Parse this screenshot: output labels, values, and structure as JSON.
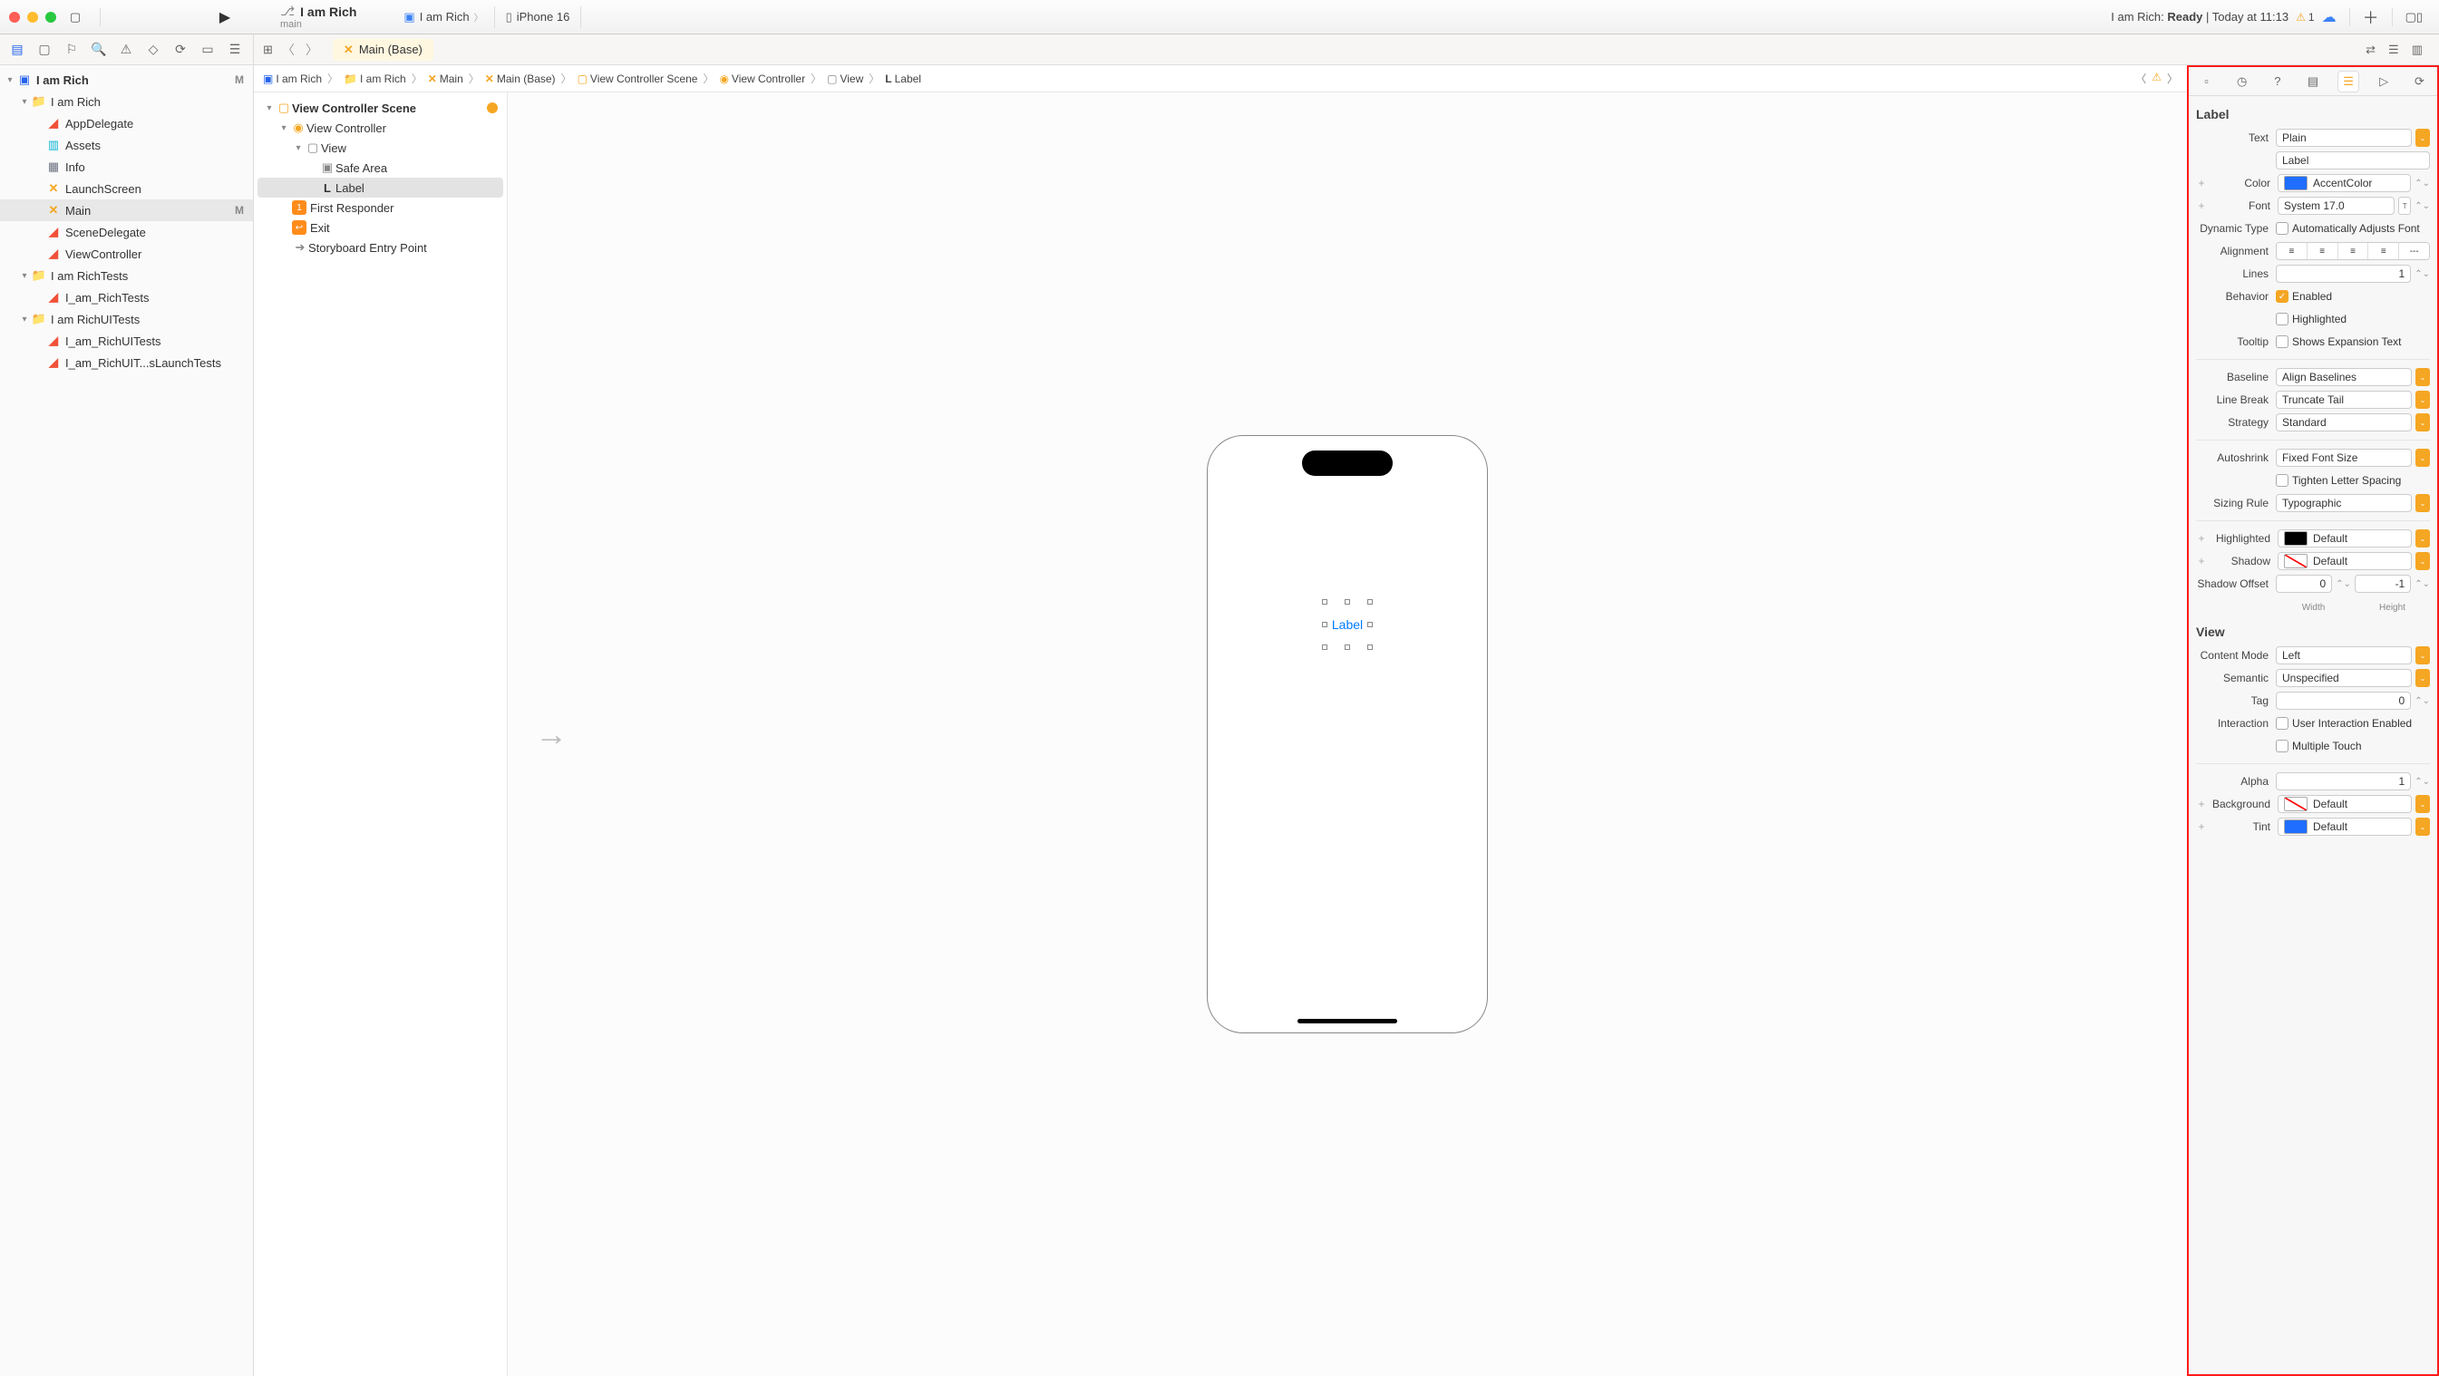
{
  "toolbar": {
    "scheme_title": "I am Rich",
    "scheme_branch": "main",
    "tab_scheme": "I am Rich",
    "tab_device": "iPhone 16",
    "status_prefix": "I am Rich: ",
    "status_bold": "Ready",
    "status_suffix": " | Today at 11:13",
    "warning_count": "1"
  },
  "filetab": {
    "label": "Main (Base)"
  },
  "navigator": {
    "project": "I am Rich",
    "project_m": "M",
    "target": "I am Rich",
    "files": {
      "appdelegate": "AppDelegate",
      "assets": "Assets",
      "info": "Info",
      "launchscreen": "LaunchScreen",
      "main": "Main",
      "main_m": "M",
      "scenedelegate": "SceneDelegate",
      "viewcontroller": "ViewController"
    },
    "tests_group": "I am RichTests",
    "tests_file": "I_am_RichTests",
    "uitests_group": "I am RichUITests",
    "uitests_file1": "I_am_RichUITests",
    "uitests_file2": "I_am_RichUIT...sLaunchTests"
  },
  "jumpbar": {
    "p1": "I am Rich",
    "p2": "I am Rich",
    "p3": "Main",
    "p4": "Main (Base)",
    "p5": "View Controller Scene",
    "p6": "View Controller",
    "p7": "View",
    "p8": "Label"
  },
  "outline": {
    "scene": "View Controller Scene",
    "vc": "View Controller",
    "view": "View",
    "safe": "Safe Area",
    "label": "Label",
    "first": "First Responder",
    "exit": "Exit",
    "entry": "Storyboard Entry Point"
  },
  "canvas": {
    "label_text": "Label"
  },
  "annotation": {
    "inspector": "inspector"
  },
  "inspector": {
    "section_label": "Label",
    "text_label": "Text",
    "text_type": "Plain",
    "text_value": "Label",
    "color_label": "Color",
    "color_value": "AccentColor",
    "font_label": "Font",
    "font_value": "System 17.0",
    "dynamic_label": "Dynamic Type",
    "dynamic_check": "Automatically Adjusts Font",
    "alignment_label": "Alignment",
    "lines_label": "Lines",
    "lines_value": "1",
    "behavior_label": "Behavior",
    "behavior_enabled": "Enabled",
    "behavior_highlighted": "Highlighted",
    "tooltip_label": "Tooltip",
    "tooltip_check": "Shows Expansion Text",
    "baseline_label": "Baseline",
    "baseline_value": "Align Baselines",
    "linebreak_label": "Line Break",
    "linebreak_value": "Truncate Tail",
    "strategy_label": "Strategy",
    "strategy_value": "Standard",
    "autoshrink_label": "Autoshrink",
    "autoshrink_value": "Fixed Font Size",
    "tighten_check": "Tighten Letter Spacing",
    "sizing_label": "Sizing Rule",
    "sizing_value": "Typographic",
    "highlighted_label": "Highlighted",
    "highlighted_value": "Default",
    "shadow_label": "Shadow",
    "shadow_value": "Default",
    "shadowoffset_label": "Shadow Offset",
    "shadow_w": "0",
    "shadow_h": "-1",
    "width_sub": "Width",
    "height_sub": "Height",
    "section_view": "View",
    "contentmode_label": "Content Mode",
    "contentmode_value": "Left",
    "semantic_label": "Semantic",
    "semantic_value": "Unspecified",
    "tag_label": "Tag",
    "tag_value": "0",
    "interaction_label": "Interaction",
    "interaction_check1": "User Interaction Enabled",
    "interaction_check2": "Multiple Touch",
    "alpha_label": "Alpha",
    "alpha_value": "1",
    "background_label": "Background",
    "background_value": "Default",
    "tint_label": "Tint",
    "tint_value": "Default"
  }
}
